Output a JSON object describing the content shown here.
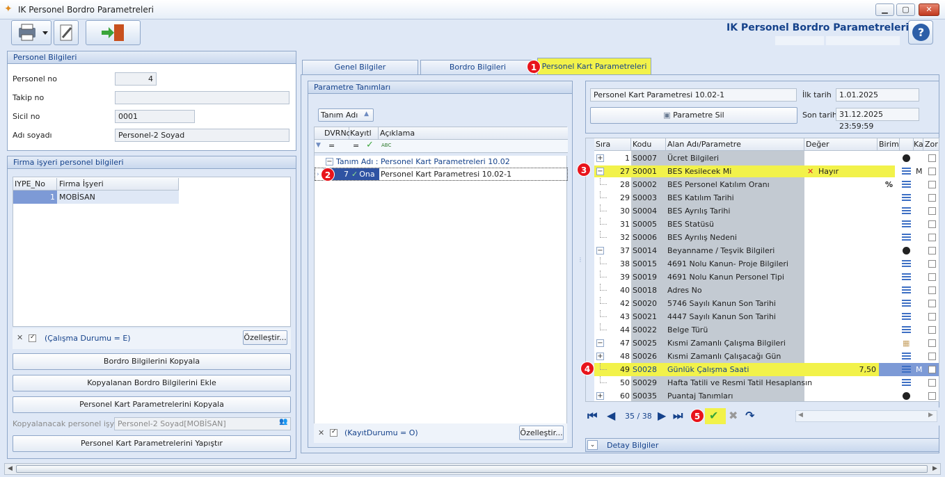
{
  "window": {
    "title": "IK Personel Bordro Parametreleri",
    "header_title": "IK Personel Bordro Parametreleri",
    "min": "▁",
    "max": "▢",
    "close": "✕"
  },
  "personel": {
    "head": "Personel Bilgileri",
    "no_label": "Personel no",
    "no_value": "4",
    "takip_label": "Takip no",
    "takip_value": "",
    "sicil_label": "Sicil no",
    "sicil_value": "0001",
    "ad_label": "Adı soyadı",
    "ad_value": "Personel-2 Soyad"
  },
  "firma": {
    "head": "Firma işyeri personel bilgileri",
    "col1": "IYPE_No",
    "col2": "Firma İşyeri",
    "row_no": "1",
    "row_name": "MOBİSAN",
    "filter": "(Çalışma Durumu = E)",
    "customize": "Özelleştir..."
  },
  "buttons": {
    "kopyala": "Bordro Bilgilerini Kopyala",
    "ekle": "Kopyalanan Bordro Bilgilerini Ekle",
    "kart_kopyala": "Personel Kart Parametrelerini Kopyala",
    "kopyalanacak_label": "Kopyalanacak personel işyeri",
    "kopyalanacak_value": "Personel-2 Soyad[MOBİSAN]",
    "yapistir": "Personel Kart Parametrelerini Yapıştır"
  },
  "tabs": [
    "Genel Bilgiler",
    "Bordro Bilgileri",
    "Personel Kart Parametreleri"
  ],
  "badges": [
    "1",
    "2",
    "3",
    "4",
    "5"
  ],
  "tanim": {
    "head": "Parametre Tanımları",
    "group_btn": "Tanım Adı",
    "col_dvr": "DVRNo",
    "col_kayit": "Kayıtl",
    "col_aciklama": "Açıklama",
    "filter_eq": "=",
    "filter_abc": "ABC",
    "group_row": "Tanım Adı : Personel Kart Parametreleri 10.02",
    "row_no": "7",
    "row_status": "Ona",
    "row_desc": "Personel Kart Parametresi 10.02-1",
    "filter": "(KayıtDurumu = O)",
    "customize": "Özelleştir..."
  },
  "detail": {
    "name": "Personel Kart Parametresi 10.02-1",
    "ilk_label": "İlk tarih",
    "ilk_value": "1.01.2025",
    "son_label": "Son tarih",
    "son_value": "31.12.2025 23:59:59",
    "sil": "Parametre Sil"
  },
  "params": {
    "col_sira": "Sıra",
    "col_kodu": "Kodu",
    "col_alan": "Alan Adı/Parametre",
    "col_deger": "Değer",
    "col_birim": "Birim",
    "col_k": "Ka",
    "col_zor": "Zor",
    "rows": [
      {
        "sira": "1",
        "kod": "S0007",
        "alan": "Ücret Bilgileri",
        "deger": "",
        "birim": "",
        "icon": "dot",
        "m": "",
        "pm": "+"
      },
      {
        "sira": "27",
        "kod": "S0001",
        "alan": "BES Kesilecek Mi",
        "deger": "Hayır",
        "birim": "",
        "icon": "lines",
        "m": "M",
        "pm": "−"
      },
      {
        "sira": "28",
        "kod": "S0002",
        "alan": "BES Personel Katılım Oranı",
        "deger": "",
        "birim": "%",
        "icon": "lines",
        "m": "",
        "pm": ""
      },
      {
        "sira": "29",
        "kod": "S0003",
        "alan": "BES Katılım Tarihi",
        "deger": "",
        "birim": "",
        "icon": "lines",
        "m": "",
        "pm": ""
      },
      {
        "sira": "30",
        "kod": "S0004",
        "alan": "BES Ayrılış Tarihi",
        "deger": "",
        "birim": "",
        "icon": "lines",
        "m": "",
        "pm": ""
      },
      {
        "sira": "31",
        "kod": "S0005",
        "alan": "BES Statüsü",
        "deger": "",
        "birim": "",
        "icon": "lines",
        "m": "",
        "pm": ""
      },
      {
        "sira": "32",
        "kod": "S0006",
        "alan": "BES Ayrılış Nedeni",
        "deger": "",
        "birim": "",
        "icon": "lines",
        "m": "",
        "pm": ""
      },
      {
        "sira": "37",
        "kod": "S0014",
        "alan": "Beyanname / Teşvik Bilgileri",
        "deger": "",
        "birim": "",
        "icon": "dot",
        "m": "",
        "pm": "−"
      },
      {
        "sira": "38",
        "kod": "S0015",
        "alan": "4691 Nolu Kanun- Proje Bilgileri",
        "deger": "",
        "birim": "",
        "icon": "lines",
        "m": "",
        "pm": ""
      },
      {
        "sira": "39",
        "kod": "S0019",
        "alan": "4691 Nolu Kanun Personel Tipi",
        "deger": "",
        "birim": "",
        "icon": "lines",
        "m": "",
        "pm": ""
      },
      {
        "sira": "40",
        "kod": "S0018",
        "alan": "Adres No",
        "deger": "",
        "birim": "",
        "icon": "lines",
        "m": "",
        "pm": ""
      },
      {
        "sira": "42",
        "kod": "S0020",
        "alan": "5746 Sayılı Kanun Son Tarihi",
        "deger": "",
        "birim": "",
        "icon": "lines",
        "m": "",
        "pm": ""
      },
      {
        "sira": "43",
        "kod": "S0021",
        "alan": "4447 Sayılı Kanun Son Tarihi",
        "deger": "",
        "birim": "",
        "icon": "lines",
        "m": "",
        "pm": ""
      },
      {
        "sira": "44",
        "kod": "S0022",
        "alan": "Belge Türü",
        "deger": "",
        "birim": "",
        "icon": "lines",
        "m": "",
        "pm": ""
      },
      {
        "sira": "47",
        "kod": "S0025",
        "alan": "Kısmi Zamanlı Çalışma Bilgileri",
        "deger": "",
        "birim": "",
        "icon": "grid",
        "m": "",
        "pm": "−"
      },
      {
        "sira": "48",
        "kod": "S0026",
        "alan": "Kısmi Zamanlı Çalışacağı Gün",
        "deger": "",
        "birim": "",
        "icon": "lines",
        "m": "",
        "pm": "+"
      },
      {
        "sira": "49",
        "kod": "S0028",
        "alan": "Günlük Çalışma Saati",
        "deger": "7,50",
        "birim": "",
        "icon": "lines",
        "m": "M",
        "pm": ""
      },
      {
        "sira": "50",
        "kod": "S0029",
        "alan": "Hafta Tatili ve Resmi Tatil Hesaplansın",
        "deger": "",
        "birim": "",
        "icon": "lines",
        "m": "",
        "pm": ""
      },
      {
        "sira": "60",
        "kod": "S0035",
        "alan": "Puantaj Tanımları",
        "deger": "",
        "birim": "",
        "icon": "dot",
        "m": "",
        "pm": "+"
      }
    ]
  },
  "pager": {
    "text": "35 / 38"
  },
  "detay": {
    "label": "Detay Bilgiler"
  }
}
